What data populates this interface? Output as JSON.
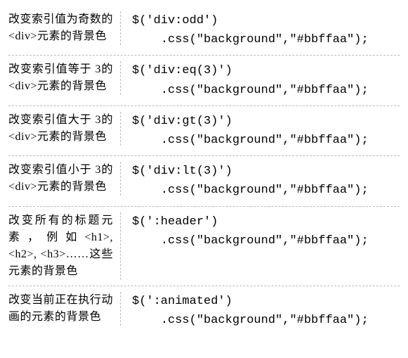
{
  "rows": [
    {
      "desc": "改变索引值为奇数的<div>元素的背景色",
      "code": "$('div:odd')\n    .css(\"background\",\"#bbffaa\");"
    },
    {
      "desc": "改变索引值等于 3的<div>元素的背景色",
      "code": "$('div:eq(3)')\n    .css(\"background\",\"#bbffaa\");"
    },
    {
      "desc": "改变索引值大于 3的<div>元素的背景色",
      "code": "$('div:gt(3)')\n    .css(\"background\",\"#bbffaa\");"
    },
    {
      "desc": "改变索引值小于 3的<div>元素的背景色",
      "code": "$('div:lt(3)')\n    .css(\"background\",\"#bbffaa\");"
    },
    {
      "desc": "改变所有的标题元素，例如<h1>, <h2>, <h3>……这些元素的背景色",
      "code": "$(':header')\n    .css(\"background\",\"#bbffaa\");"
    },
    {
      "desc": "改变当前正在执行动画的元素的背景色",
      "code": "$(':animated')\n    .css(\"background\",\"#bbffaa\");"
    }
  ]
}
